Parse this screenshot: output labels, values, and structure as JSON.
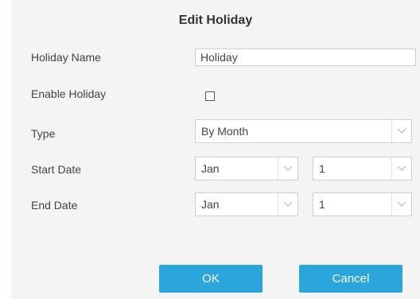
{
  "dialog": {
    "title": "Edit Holiday"
  },
  "form": {
    "holiday_name": {
      "label": "Holiday Name",
      "value": "Holiday"
    },
    "enable_holiday": {
      "label": "Enable Holiday",
      "checked": false
    },
    "type": {
      "label": "Type",
      "value": "By Month"
    },
    "start_date": {
      "label": "Start Date",
      "month": "Jan",
      "day": "1"
    },
    "end_date": {
      "label": "End Date",
      "month": "Jan",
      "day": "1"
    }
  },
  "buttons": {
    "ok": "OK",
    "cancel": "Cancel"
  },
  "colors": {
    "primary_button": "#2aa6dd",
    "dialog_background": "#f4f4f4"
  },
  "icons": {
    "dropdown": "chevron-down-icon"
  }
}
